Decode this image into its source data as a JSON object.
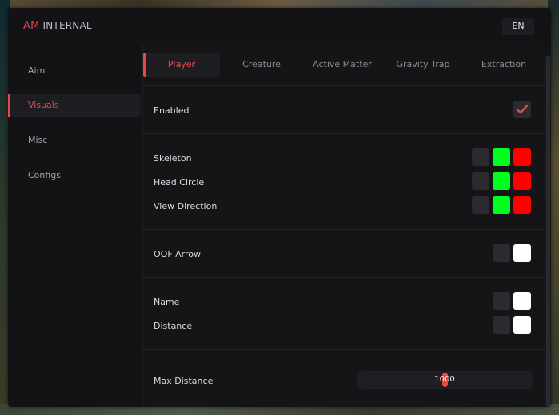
{
  "app": {
    "brand": "AM",
    "title": "INTERNAL",
    "lang": "EN"
  },
  "sidebar": {
    "items": [
      {
        "label": "Aim",
        "active": false
      },
      {
        "label": "Visuals",
        "active": true
      },
      {
        "label": "Misc",
        "active": false
      },
      {
        "label": "Configs",
        "active": false
      }
    ]
  },
  "tabs": [
    {
      "label": "Player",
      "active": true
    },
    {
      "label": "Creature",
      "active": false
    },
    {
      "label": "Active Matter",
      "active": false
    },
    {
      "label": "Gravity Trap",
      "active": false
    },
    {
      "label": "Extraction",
      "active": false
    }
  ],
  "settings": {
    "enabled": {
      "label": "Enabled",
      "checked": true
    },
    "skeleton": {
      "label": "Skeleton",
      "colors": [
        "#2a2a2f",
        "#00ff1e",
        "#ff0000"
      ]
    },
    "head_circle": {
      "label": "Head Circle",
      "colors": [
        "#2a2a2f",
        "#00ff1e",
        "#ff0000"
      ]
    },
    "view_direction": {
      "label": "View Direction",
      "colors": [
        "#2a2a2f",
        "#00ff1e",
        "#ff0000"
      ]
    },
    "oof_arrow": {
      "label": "OOF Arrow",
      "colors": [
        "#2a2a2f",
        "#ffffff"
      ]
    },
    "name": {
      "label": "Name",
      "colors": [
        "#2a2a2f",
        "#ffffff"
      ]
    },
    "distance": {
      "label": "Distance",
      "colors": [
        "#2a2a2f",
        "#ffffff"
      ]
    },
    "max_distance": {
      "label": "Max Distance",
      "value": "1000"
    }
  },
  "colors": {
    "accent": "#e84a4a",
    "panel": "#131316",
    "content": "#151518"
  },
  "icons": {
    "check": "check-icon"
  }
}
